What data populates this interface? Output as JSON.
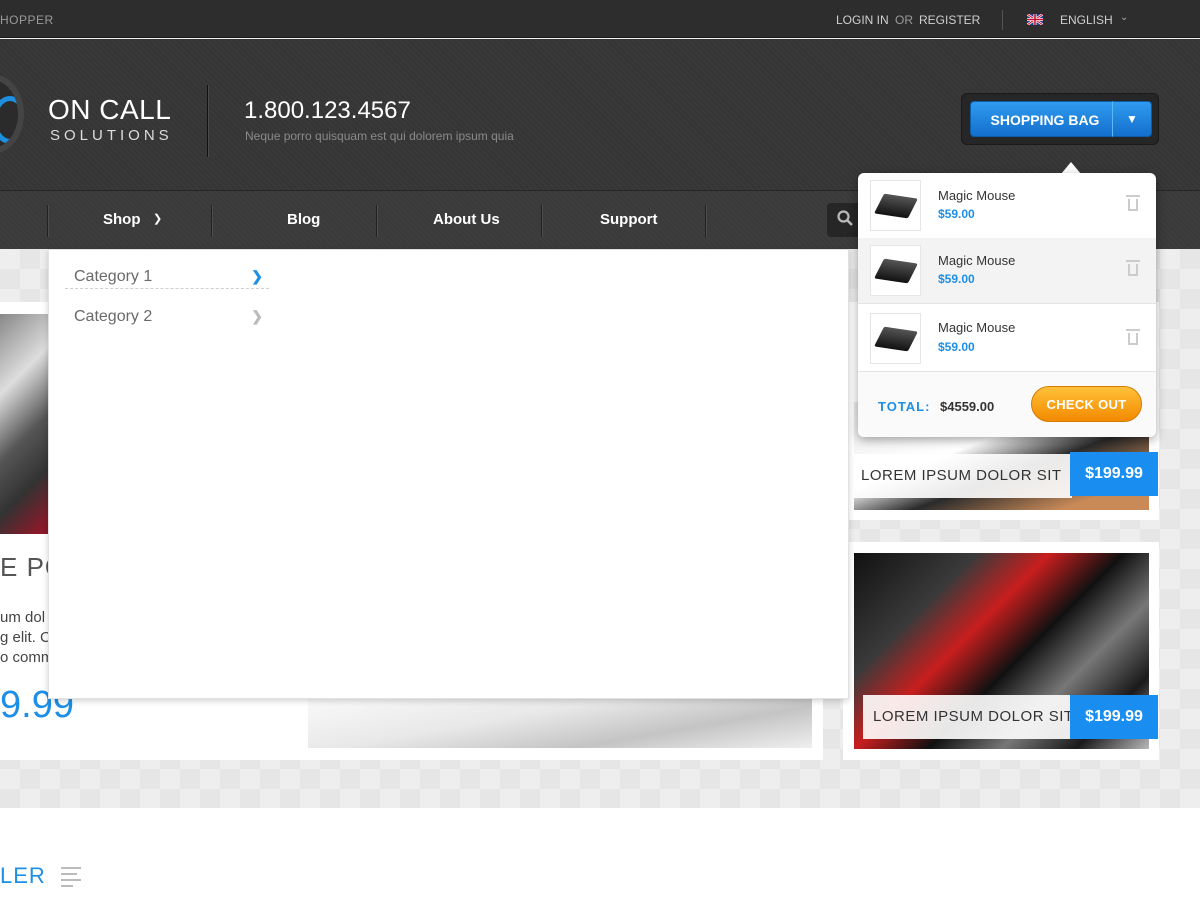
{
  "topbar": {
    "brand": "HOPPER",
    "login": "LOGIN IN",
    "or": "OR",
    "register": "REGISTER",
    "language": "ENGLISH"
  },
  "header": {
    "logo_title": "ON CALL",
    "logo_subtitle": "SOLUTIONS",
    "phone": "1.800.123.4567",
    "tagline": "Neque porro quisquam est qui dolorem ipsum quia",
    "bag_label": "SHOPPING BAG"
  },
  "nav": {
    "items": [
      "Shop",
      "Blog",
      "About Us",
      "Support"
    ]
  },
  "shop_menu": {
    "categories": [
      "Category 1",
      "Category 2"
    ]
  },
  "cart": {
    "items": [
      {
        "name": "Magic Mouse",
        "price": "$59.00"
      },
      {
        "name": "Magic Mouse",
        "price": "$59.00"
      },
      {
        "name": "Magic Mouse",
        "price": "$59.00"
      }
    ],
    "total_label": "TOTAL:",
    "total_value": "$4559.00",
    "checkout_label": "CHECK OUT"
  },
  "feature": {
    "title": "E PO",
    "desc_lines": [
      "um dol",
      "g elit. Cr",
      "o comm"
    ],
    "price": "9.99"
  },
  "cards": [
    {
      "label": "LOREM IPSUM DOLOR SIT",
      "price": "$199.99"
    },
    {
      "label": "LOREM IPSUM DOLOR SIT",
      "price": "$199.99"
    }
  ],
  "below": {
    "section_title": "LER"
  },
  "colors": {
    "accent": "#1d8fe6",
    "checkout": "#f5a100",
    "dark_bg": "#353535"
  }
}
